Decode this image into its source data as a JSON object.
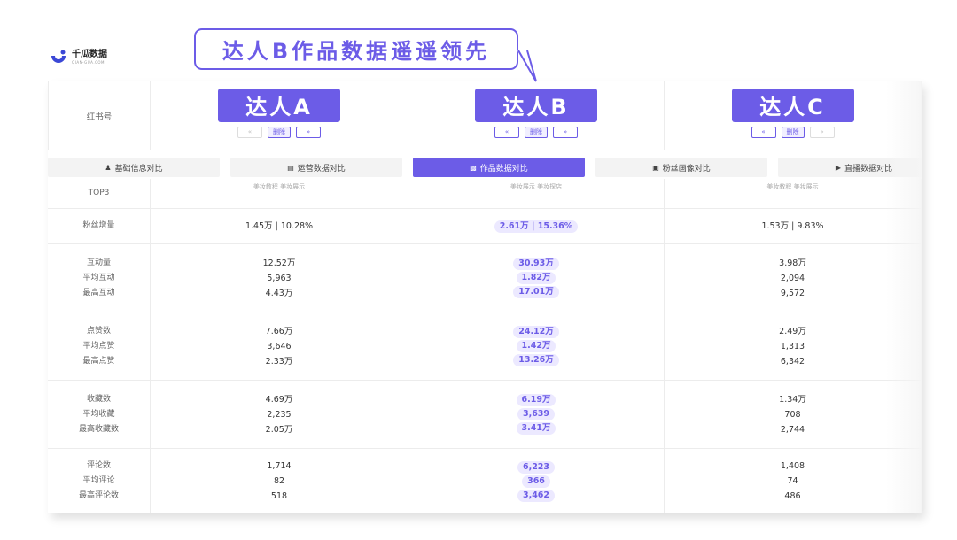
{
  "logo": {
    "name": "千瓜数据",
    "sub": "QIAN-GUA.COM"
  },
  "callout": "达人B作品数据遥遥领先",
  "header": {
    "label": "红书号",
    "talents": [
      {
        "name": "达人A",
        "prev": "«",
        "delete": "删除",
        "next": "»"
      },
      {
        "name": "达人B",
        "prev": "«",
        "delete": "删除",
        "next": "»"
      },
      {
        "name": "达人C",
        "prev": "«",
        "delete": "删除",
        "next": "»"
      }
    ]
  },
  "tabs": [
    {
      "label": "基础信息对比",
      "icon": "user-icon"
    },
    {
      "label": "运营数据对比",
      "icon": "chart-icon"
    },
    {
      "label": "作品数据对比",
      "icon": "document-icon",
      "active": true
    },
    {
      "label": "粉丝画像对比",
      "icon": "fans-icon"
    },
    {
      "label": "直播数据对比",
      "icon": "live-icon"
    }
  ],
  "top3": {
    "label": "TOP3",
    "tags": [
      "美妆教程  美妆展示",
      "美妆展示  美妆探店",
      "美妆教程  美妆展示"
    ]
  },
  "fans_growth": {
    "label": "粉丝增量",
    "values": [
      "1.45万 | 10.28%",
      "2.61万 | 15.36%",
      "1.53万 | 9.83%"
    ]
  },
  "groups": [
    {
      "labels": [
        "互动量",
        "平均互动",
        "最高互动"
      ],
      "a": [
        "12.52万",
        "5,963",
        "4.43万"
      ],
      "b": [
        "30.93万",
        "1.82万",
        "17.01万"
      ],
      "c": [
        "3.98万",
        "2,094",
        "9,572"
      ]
    },
    {
      "labels": [
        "点赞数",
        "平均点赞",
        "最高点赞"
      ],
      "a": [
        "7.66万",
        "3,646",
        "2.33万"
      ],
      "b": [
        "24.12万",
        "1.42万",
        "13.26万"
      ],
      "c": [
        "2.49万",
        "1,313",
        "6,342"
      ]
    },
    {
      "labels": [
        "收藏数",
        "平均收藏",
        "最高收藏数"
      ],
      "a": [
        "4.69万",
        "2,235",
        "2.05万"
      ],
      "b": [
        "6.19万",
        "3,639",
        "3.41万"
      ],
      "c": [
        "1.34万",
        "708",
        "2,744"
      ]
    },
    {
      "labels": [
        "评论数",
        "平均评论",
        "最高评论数"
      ],
      "a": [
        "1,714",
        "82",
        "518"
      ],
      "b": [
        "6,223",
        "366",
        "3,462"
      ],
      "c": [
        "1,408",
        "74",
        "486"
      ]
    }
  ],
  "colors": {
    "accent": "#6c5ce7",
    "highlight_bg": "#ece9ff"
  }
}
